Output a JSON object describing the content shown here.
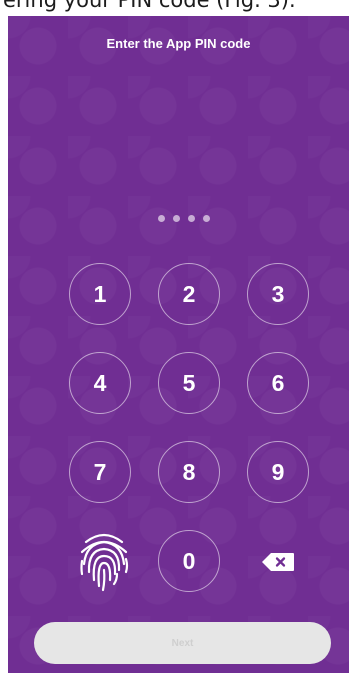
{
  "caption": {
    "text": "ering your PIN code (Fig. 3)."
  },
  "app": {
    "title": "Enter the App PIN code",
    "background_color": "#702e93",
    "pin_length": 4,
    "keypad": {
      "keys": [
        "1",
        "2",
        "3",
        "4",
        "5",
        "6",
        "7",
        "8",
        "9",
        "0"
      ],
      "fingerprint_icon": "fingerprint-icon",
      "backspace_icon": "backspace-icon"
    },
    "next_button": {
      "label": "Next",
      "state": "disabled"
    }
  }
}
